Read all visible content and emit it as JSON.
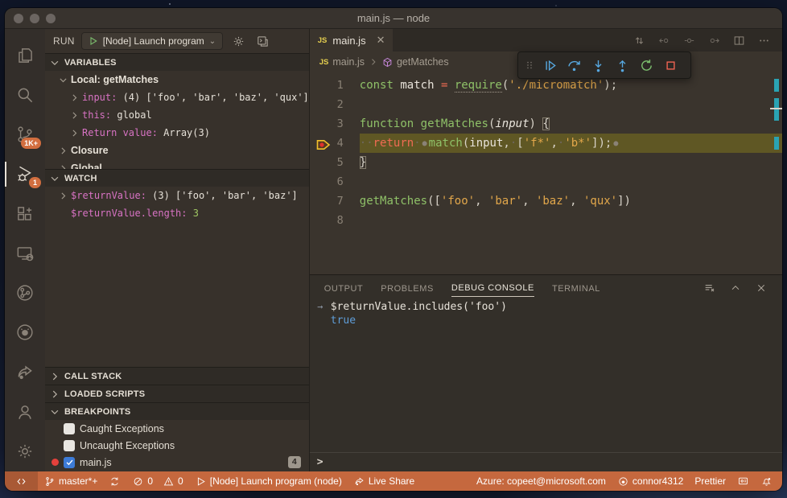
{
  "window": {
    "title": "main.js — node"
  },
  "activity": {
    "scm_badge": "1K+",
    "debug_badge": "1"
  },
  "run": {
    "label": "RUN",
    "config": "[Node] Launch program"
  },
  "sidebar": {
    "sections": {
      "variables": "VARIABLES",
      "watch": "WATCH",
      "call_stack": "CALL STACK",
      "loaded_scripts": "LOADED SCRIPTS",
      "breakpoints": "BREAKPOINTS"
    },
    "variables": {
      "rows": [
        {
          "twisty": "open",
          "indent": 1,
          "parts": [
            [
              "Local: getMatches",
              "lb"
            ]
          ]
        },
        {
          "twisty": "closed",
          "indent": 2,
          "parts": [
            [
              "input: ",
              "nm"
            ],
            [
              "(4) ['foo', 'bar', 'baz', 'qux']",
              "vl"
            ]
          ]
        },
        {
          "twisty": "closed",
          "indent": 2,
          "parts": [
            [
              "this: ",
              "nm"
            ],
            [
              "global",
              "vl"
            ]
          ]
        },
        {
          "twisty": "closed",
          "indent": 2,
          "parts": [
            [
              "Return value: ",
              "nm"
            ],
            [
              "Array(3)",
              "vl"
            ]
          ]
        },
        {
          "twisty": "closed",
          "indent": 1,
          "parts": [
            [
              "Closure",
              "lb"
            ]
          ]
        },
        {
          "twisty": "closed",
          "indent": 1,
          "parts": [
            [
              "Global",
              "lb"
            ]
          ]
        }
      ]
    },
    "watch": {
      "rows": [
        {
          "twisty": "closed",
          "indent": 1,
          "parts": [
            [
              "$returnValue: ",
              "nm"
            ],
            [
              "(3) ['foo', 'bar', 'baz']",
              "vl"
            ]
          ]
        },
        {
          "twisty": "none",
          "indent": 1,
          "parts": [
            [
              "$returnValue.length: ",
              "nm"
            ],
            [
              "3",
              "num"
            ]
          ]
        }
      ]
    },
    "breakpoints": {
      "rows": [
        {
          "dot": false,
          "checked": false,
          "label": "Caught Exceptions"
        },
        {
          "dot": false,
          "checked": false,
          "label": "Uncaught Exceptions"
        },
        {
          "dot": true,
          "checked": true,
          "label": "main.js",
          "badge": "4"
        }
      ]
    }
  },
  "editor": {
    "tab_label": "main.js",
    "js_badge": "JS",
    "breadcrumbs": [
      "main.js",
      "getMatches"
    ],
    "lines": [
      {
        "n": "1",
        "tokens": [
          [
            "const",
            "kw"
          ],
          [
            " ",
            ""
          ],
          [
            "match",
            "vr"
          ],
          [
            " ",
            ""
          ],
          [
            "=",
            "rt"
          ],
          [
            " ",
            ""
          ],
          [
            "require",
            "fn ul"
          ],
          [
            "(",
            "pn"
          ],
          [
            "'./micromatch'",
            "st"
          ],
          [
            ");",
            "pn"
          ]
        ]
      },
      {
        "n": "2",
        "tokens": []
      },
      {
        "n": "3",
        "tokens": [
          [
            "function",
            "kw"
          ],
          [
            " ",
            ""
          ],
          [
            "getMatches",
            "fn"
          ],
          [
            "(",
            "pn"
          ],
          [
            "input",
            "pm"
          ],
          [
            ")",
            "pn"
          ],
          [
            " ",
            ""
          ],
          [
            "{",
            "pn bk"
          ]
        ]
      },
      {
        "n": "4",
        "hl": true,
        "marker": true,
        "tokens": [
          [
            "··",
            "ws"
          ],
          [
            "return",
            "rt"
          ],
          [
            "·",
            "ws"
          ],
          [
            "●",
            "bp"
          ],
          [
            "match",
            "fn"
          ],
          [
            "(",
            "pn"
          ],
          [
            "input",
            "vr"
          ],
          [
            ",",
            "pn"
          ],
          [
            "·",
            "ws"
          ],
          [
            "[",
            "pn"
          ],
          [
            "'f*'",
            "st"
          ],
          [
            ",",
            "pn"
          ],
          [
            "·",
            "ws"
          ],
          [
            "'b*'",
            "st"
          ],
          [
            "]",
            "pn"
          ],
          [
            ");",
            "pn"
          ],
          [
            "●",
            "bp"
          ]
        ]
      },
      {
        "n": "5",
        "tokens": [
          [
            "}",
            "pn bk"
          ]
        ]
      },
      {
        "n": "6",
        "tokens": []
      },
      {
        "n": "7",
        "tokens": [
          [
            "getMatches",
            "fn"
          ],
          [
            "([",
            "pn"
          ],
          [
            "'foo'",
            "st"
          ],
          [
            ", ",
            "pn"
          ],
          [
            "'bar'",
            "st"
          ],
          [
            ", ",
            "pn"
          ],
          [
            "'baz'",
            "st"
          ],
          [
            ", ",
            "pn"
          ],
          [
            "'qux'",
            "st"
          ],
          [
            "])",
            "pn"
          ]
        ]
      },
      {
        "n": "8",
        "tokens": []
      }
    ]
  },
  "panel": {
    "tabs": [
      "OUTPUT",
      "PROBLEMS",
      "DEBUG CONSOLE",
      "TERMINAL"
    ],
    "console": {
      "expression": "$returnValue.includes('foo')",
      "result": "true",
      "prompt": ">"
    }
  },
  "status": {
    "branch": "master*+",
    "errors": "0",
    "warnings": "0",
    "run_config": "[Node] Launch program (node)",
    "live_share": "Live Share",
    "azure": "Azure: copeet@microsoft.com",
    "account": "connor4312",
    "prettier": "Prettier"
  },
  "colors": {
    "status_bar": "#c5683e",
    "badge": "#d26e3f",
    "accent_blue": "#57a8e0",
    "restart_green": "#7cbf6e",
    "stop_red": "#ee6352",
    "string_gold": "#e2a74b",
    "keyword_green": "#8fc168",
    "return_salmon": "#ef6b53",
    "var_name_magenta": "#d873c4",
    "number_green": "#9fc663",
    "result_blue": "#5f9ed9",
    "breakpoint_red": "#e5413c",
    "current_line_olive": "#5f5724",
    "ruler_teal": "#2aa3b3"
  }
}
